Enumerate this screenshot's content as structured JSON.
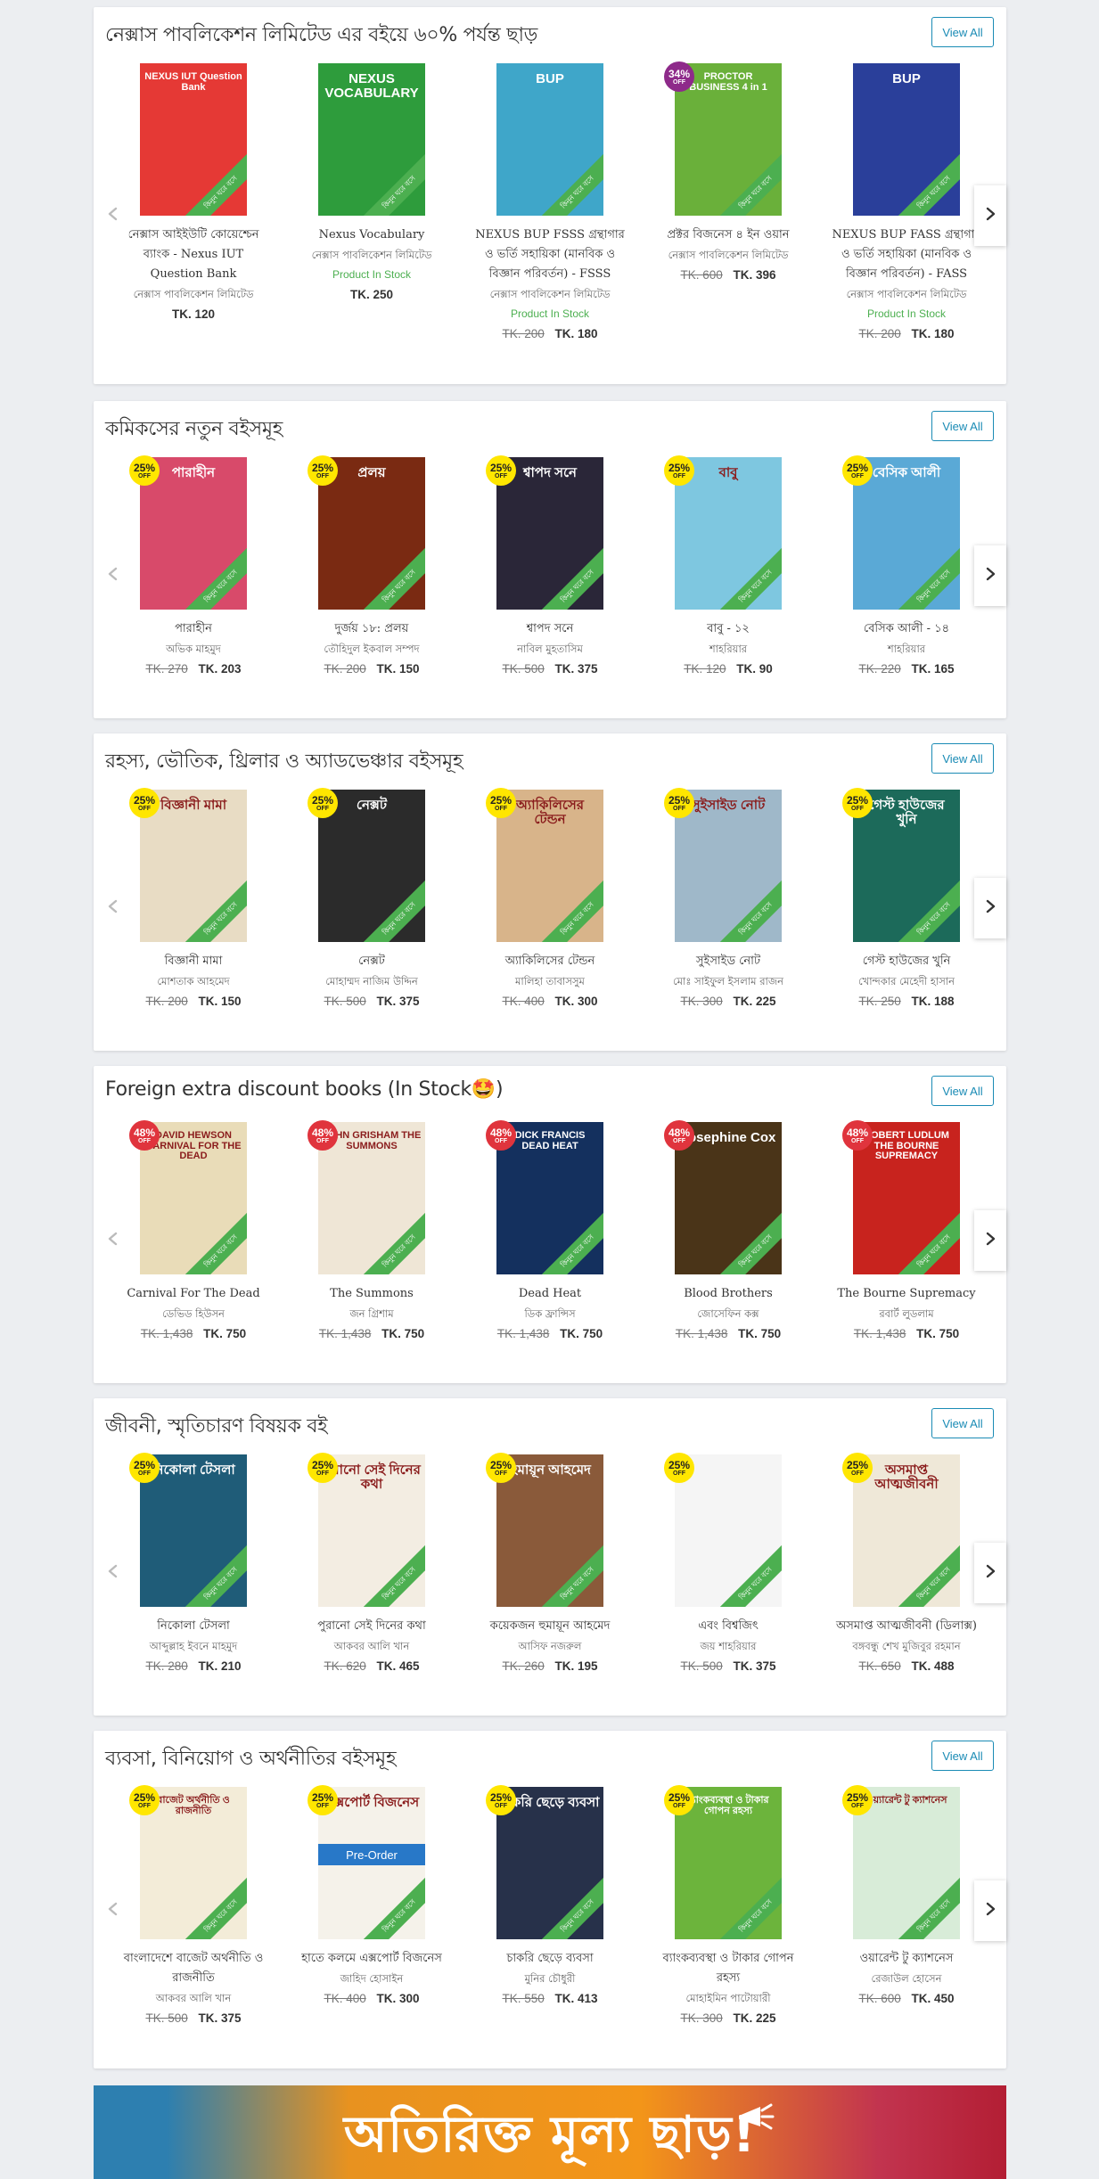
{
  "sections": [
    {
      "title": "নেক্সাস পাবলিকেশন লিমিটেড এর বইয়ে ৬০% পর্যন্ত ছাড়",
      "view_all": "View All",
      "books": [
        {
          "title": "নেক্সাস আইইউটি কোয়েশ্চেন ব্যাংক - Nexus IUT Question Bank",
          "author": "নেক্সাস পাবলিকেশন লিমিটেড",
          "stock": "",
          "old_price": "",
          "new_price": "TK. 120",
          "badge": "",
          "badge_off": "",
          "cover_text": "NEXUS IUT Question Bank",
          "cover_color": "#e53935"
        },
        {
          "title": "Nexus Vocabulary",
          "author": "নেক্সাস পাবলিকেশন লিমিটেড",
          "stock": "Product In Stock",
          "old_price": "",
          "new_price": "TK. 250",
          "badge": "",
          "badge_off": "",
          "cover_text": "NEXUS VOCABULARY",
          "cover_color": "#2e9c3c"
        },
        {
          "title": "NEXUS BUP FSSS গ্রন্থাগার ও ভর্তি সহায়িকা (মানবিক ও বিজ্ঞান পরিবর্তন) - FSSS",
          "author": "নেক্সাস পাবলিকেশন লিমিটেড",
          "stock": "Product In Stock",
          "old_price": "TK. 200",
          "new_price": "TK. 180",
          "badge": "",
          "badge_off": "",
          "cover_text": "BUP",
          "cover_color": "#3fa6c9"
        },
        {
          "title": "প্রক্টর বিজনেস ৪ ইন ওয়ান",
          "author": "নেক্সাস পাবলিকেশন লিমিটেড",
          "stock": "",
          "old_price": "TK. 600",
          "new_price": "TK. 396",
          "badge": "34%",
          "badge_off": "OFF",
          "cover_text": "PROCTOR BUSINESS 4 in 1",
          "cover_color": "#6ab03a"
        },
        {
          "title": "NEXUS BUP FASS গ্রন্থাগার ও ভর্তি সহায়িকা (মানবিক ও বিজ্ঞান পরিবর্তন) - FASS",
          "author": "নেক্সাস পাবলিকেশন লিমিটেড",
          "stock": "Product In Stock",
          "old_price": "TK. 200",
          "new_price": "TK. 180",
          "badge": "",
          "badge_off": "",
          "cover_text": "BUP",
          "cover_color": "#2a3f9a"
        }
      ]
    },
    {
      "title": "কমিকসের নতুন বইসমূহ",
      "view_all": "View All",
      "books": [
        {
          "title": "পারাহীন",
          "author": "অভিক মাহমুদ",
          "stock": "",
          "old_price": "TK. 270",
          "new_price": "TK. 203",
          "badge": "25%",
          "badge_off": "OFF",
          "cover_text": "পারাহীন",
          "cover_color": "#d84a6a"
        },
        {
          "title": "দুর্জয় ১৮: প্রলয়",
          "author": "তৌহিদুল ইকবাল সম্পদ",
          "stock": "",
          "old_price": "TK. 200",
          "new_price": "TK. 150",
          "badge": "25%",
          "badge_off": "OFF",
          "cover_text": "প্রলয়",
          "cover_color": "#7a2a12"
        },
        {
          "title": "শ্বাপদ সনে",
          "author": "নাবিল মুহতাসিম",
          "stock": "",
          "old_price": "TK. 500",
          "new_price": "TK. 375",
          "badge": "25%",
          "badge_off": "OFF",
          "cover_text": "শ্বাপদ সনে",
          "cover_color": "#2a2638"
        },
        {
          "title": "বাবু - ১২",
          "author": "শাহরিয়ার",
          "stock": "",
          "old_price": "TK. 120",
          "new_price": "TK. 90",
          "badge": "25%",
          "badge_off": "OFF",
          "cover_text": "বাবু",
          "cover_color": "#7ec7e0"
        },
        {
          "title": "বেসিক আলী - ১৪",
          "author": "শাহরিয়ার",
          "stock": "",
          "old_price": "TK. 220",
          "new_price": "TK. 165",
          "badge": "25%",
          "badge_off": "OFF",
          "cover_text": "বেসিক আলী",
          "cover_color": "#5aa9d6"
        }
      ]
    },
    {
      "title": "রহস্য, ভৌতিক, থ্রিলার ও অ্যাডভেঞ্চার বইসমূহ",
      "view_all": "View All",
      "books": [
        {
          "title": "বিজ্ঞানী মামা",
          "author": "মোশতাক আহমেদ",
          "stock": "",
          "old_price": "TK. 200",
          "new_price": "TK. 150",
          "badge": "25%",
          "badge_off": "OFF",
          "cover_text": "বিজ্ঞানী মামা",
          "cover_color": "#e8dcc4"
        },
        {
          "title": "নেক্সট",
          "author": "মোহাম্মদ নাজিম উদ্দিন",
          "stock": "",
          "old_price": "TK. 500",
          "new_price": "TK. 375",
          "badge": "25%",
          "badge_off": "OFF",
          "cover_text": "নেক্সট",
          "cover_color": "#2b2b2b"
        },
        {
          "title": "অ্যাকিলিসের টেন্ডন",
          "author": "মালিহা তাবাসসুম",
          "stock": "",
          "old_price": "TK. 400",
          "new_price": "TK. 300",
          "badge": "25%",
          "badge_off": "OFF",
          "cover_text": "অ্যাকিলিসের টেন্ডন",
          "cover_color": "#d8b48a"
        },
        {
          "title": "সুইসাইড নোট",
          "author": "মোঃ সাইফুল ইসলাম রাজন",
          "stock": "",
          "old_price": "TK. 300",
          "new_price": "TK. 225",
          "badge": "25%",
          "badge_off": "OFF",
          "cover_text": "সুইসাইড নোট",
          "cover_color": "#9fb8c9"
        },
        {
          "title": "গেস্ট হাউজের খুনি",
          "author": "খোন্দকার মেহেদী হাসান",
          "stock": "",
          "old_price": "TK. 250",
          "new_price": "TK. 188",
          "badge": "25%",
          "badge_off": "OFF",
          "cover_text": "গেস্ট হাউজের খুনি",
          "cover_color": "#1c6a5a"
        }
      ]
    },
    {
      "title": "Foreign extra discount books (In Stock🤩)",
      "view_all": "View All",
      "books": [
        {
          "title": "Carnival For The Dead",
          "author": "ডেভিড হিউসন",
          "stock": "",
          "old_price": "TK. 1,438",
          "new_price": "TK. 750",
          "badge": "48%",
          "badge_off": "OFF",
          "cover_text": "DAVID HEWSON CARNIVAL FOR THE DEAD",
          "cover_color": "#e9dcb8"
        },
        {
          "title": "The Summons",
          "author": "জন গ্রিশাম",
          "stock": "",
          "old_price": "TK. 1,438",
          "new_price": "TK. 750",
          "badge": "48%",
          "badge_off": "OFF",
          "cover_text": "JOHN GRISHAM THE SUMMONS",
          "cover_color": "#efe6d6"
        },
        {
          "title": "Dead Heat",
          "author": "ডিক ফ্রান্সিস",
          "stock": "",
          "old_price": "TK. 1,438",
          "new_price": "TK. 750",
          "badge": "48%",
          "badge_off": "OFF",
          "cover_text": "DICK FRANCIS DEAD HEAT",
          "cover_color": "#14305e"
        },
        {
          "title": "Blood Brothers",
          "author": "জোসেফিন কক্স",
          "stock": "",
          "old_price": "TK. 1,438",
          "new_price": "TK. 750",
          "badge": "48%",
          "badge_off": "OFF",
          "cover_text": "Josephine Cox",
          "cover_color": "#4a3418"
        },
        {
          "title": "The Bourne Supremacy",
          "author": "রবার্ট লুডলাম",
          "stock": "",
          "old_price": "TK. 1,438",
          "new_price": "TK. 750",
          "badge": "48%",
          "badge_off": "OFF",
          "cover_text": "ROBERT LUDLUM THE BOURNE SUPREMACY",
          "cover_color": "#c8231e"
        }
      ]
    },
    {
      "title": "জীবনী, স্মৃতিচারণ বিষয়ক বই",
      "view_all": "View All",
      "books": [
        {
          "title": "নিকোলা টেসলা",
          "author": "আব্দুল্লাহ ইবনে মাহমুদ",
          "stock": "",
          "old_price": "TK. 280",
          "new_price": "TK. 210",
          "badge": "25%",
          "badge_off": "OFF",
          "cover_text": "নিকোলা টেসলা",
          "cover_color": "#1f5c78"
        },
        {
          "title": "পুরানো সেই দিনের কথা",
          "author": "আকবর আলি খান",
          "stock": "",
          "old_price": "TK. 620",
          "new_price": "TK. 465",
          "badge": "25%",
          "badge_off": "OFF",
          "cover_text": "পুরানো সেই দিনের কথা",
          "cover_color": "#f3ede2"
        },
        {
          "title": "কয়েকজন হুমায়ূন আহমেদ",
          "author": "আসিফ নজরুল",
          "stock": "",
          "old_price": "TK. 260",
          "new_price": "TK. 195",
          "badge": "25%",
          "badge_off": "OFF",
          "cover_text": "হুমায়ূন আহমেদ",
          "cover_color": "#8a5a3a"
        },
        {
          "title": "এবং বিশ্বজিৎ",
          "author": "জয় শাহরিয়ার",
          "stock": "",
          "old_price": "TK. 500",
          "new_price": "TK. 375",
          "badge": "25%",
          "badge_off": "OFF",
          "cover_text": "",
          "cover_color": "#f5f5f5"
        },
        {
          "title": "অসমাপ্ত আত্মজীবনী (ডিলাক্স)",
          "author": "বঙ্গবন্ধু শেখ মুজিবুর রহমান",
          "stock": "",
          "old_price": "TK. 650",
          "new_price": "TK. 488",
          "badge": "25%",
          "badge_off": "OFF",
          "cover_text": "অসমাপ্ত আত্মজীবনী",
          "cover_color": "#efe8d8"
        }
      ]
    },
    {
      "title": "ব্যবসা, বিনিয়োগ ও অর্থনীতির বইসমূহ",
      "view_all": "View All",
      "books": [
        {
          "title": "বাংলাদেশে বাজেট অর্থনীতি ও রাজনীতি",
          "author": "আকবর আলি খান",
          "stock": "",
          "old_price": "TK. 500",
          "new_price": "TK. 375",
          "badge": "25%",
          "badge_off": "OFF",
          "cover_text": "বাজেট অর্থনীতি ও রাজনীতি",
          "cover_color": "#f3ecd8"
        },
        {
          "title": "হাতে কলমে এক্সপোর্ট বিজনেস",
          "author": "জাহিদ হোসাইন",
          "stock": "",
          "old_price": "TK. 400",
          "new_price": "TK. 300",
          "badge": "25%",
          "badge_off": "OFF",
          "cover_text": "এক্সপোর্ট বিজনেস",
          "cover_color": "#f5f2ea",
          "preorder": "Pre-Order"
        },
        {
          "title": "চাকরি ছেড়ে ব্যবসা",
          "author": "মুনির চৌধুরী",
          "stock": "",
          "old_price": "TK. 550",
          "new_price": "TK. 413",
          "badge": "25%",
          "badge_off": "OFF",
          "cover_text": "চাকরি ছেড়ে ব্যবসা",
          "cover_color": "#27314a"
        },
        {
          "title": "ব্যাংকব্যবস্থা ও টাকার গোপন রহস্য",
          "author": "মোহাইমিন পাটোয়ারী",
          "stock": "",
          "old_price": "TK. 300",
          "new_price": "TK. 225",
          "badge": "25%",
          "badge_off": "OFF",
          "cover_text": "ব্যাংকব্যবস্থা ও টাকার গোপন রহস্য",
          "cover_color": "#6cb43c"
        },
        {
          "title": "ওয়ারেন্ট টু ক্যাশনেস",
          "author": "রেজাউল হোসেন",
          "stock": "",
          "old_price": "TK. 600",
          "new_price": "TK. 450",
          "badge": "25%",
          "badge_off": "OFF",
          "cover_text": "ওয়্যারেন্ট টু ক্যাশনেস",
          "cover_color": "#d8ecd8"
        }
      ]
    }
  ],
  "ribbon_text": "কিনুন ঘরে বসে",
  "banner": {
    "text": "অতিরিক্ত মূল্য ছাড়!"
  },
  "colors": {
    "accent": "#1a8bb5",
    "stock": "#4caf50",
    "badge_yellow": "#ffe600",
    "badge_red": "#e0343d",
    "badge_purple": "#8e2a8a"
  }
}
